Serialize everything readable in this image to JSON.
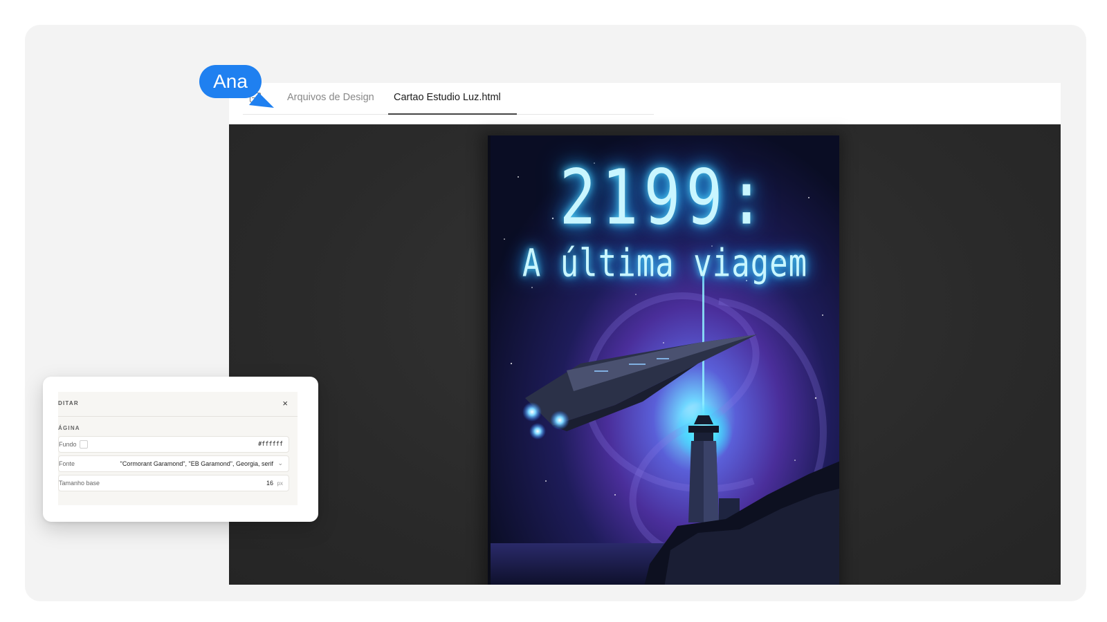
{
  "user": {
    "name": "Ana"
  },
  "tabs": [
    {
      "label": "Arquivos de Design",
      "active": false
    },
    {
      "label": "Cartao Estudio Luz.html",
      "active": true
    }
  ],
  "book": {
    "title_line1": "2199:",
    "title_line2": "A última viagem"
  },
  "edit_panel": {
    "title": "DITAR",
    "close_label": "×",
    "section": "ÁGINA",
    "fields": {
      "background": {
        "label": "Fundo",
        "value": "#ffffff"
      },
      "font": {
        "label": "Fonte",
        "value": "\"Cormorant Garamond\", \"EB Garamond\", Georgia, serif"
      },
      "base_size": {
        "label": "Tamanho base",
        "value": "16",
        "unit": "px"
      }
    }
  },
  "colors": {
    "accent": "#1f80f0",
    "canvas": "#2a2a2a",
    "cover_glow": "#4fd8ff"
  }
}
